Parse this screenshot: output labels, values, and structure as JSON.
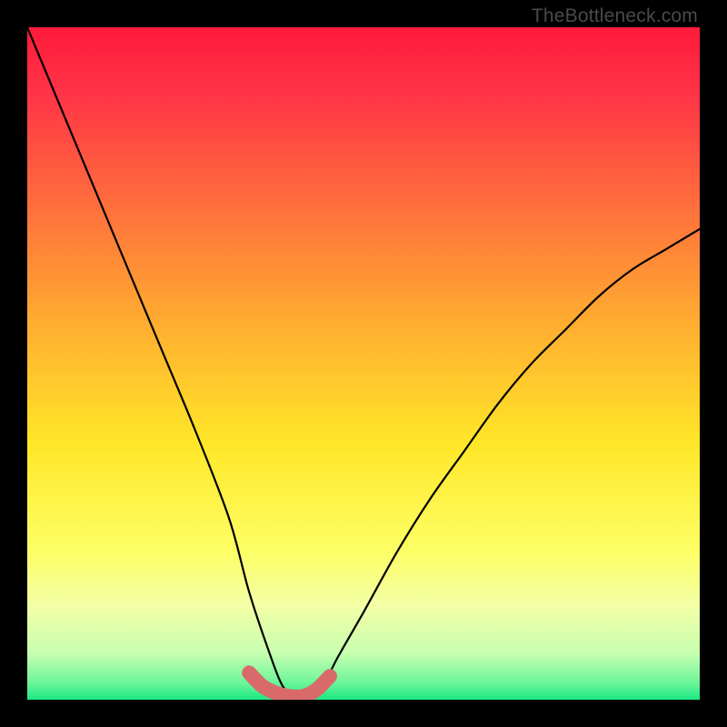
{
  "attribution": "TheBottleneck.com",
  "chart_data": {
    "type": "line",
    "title": "",
    "xlabel": "",
    "ylabel": "",
    "xlim": [
      0,
      100
    ],
    "ylim": [
      0,
      100
    ],
    "series": [
      {
        "name": "bottleneck-curve",
        "x": [
          0,
          5,
          10,
          15,
          20,
          25,
          30,
          33,
          36,
          38,
          40,
          42,
          44,
          46,
          50,
          55,
          60,
          65,
          70,
          75,
          80,
          85,
          90,
          95,
          100
        ],
        "y": [
          100,
          88,
          76,
          64,
          52,
          40,
          27,
          16,
          7,
          2,
          0,
          0,
          2,
          6,
          13,
          22,
          30,
          37,
          44,
          50,
          55,
          60,
          64,
          67,
          70
        ]
      },
      {
        "name": "optimal-highlight",
        "x": [
          33,
          35,
          37,
          39,
          41,
          43,
          45
        ],
        "y": [
          4,
          2,
          1,
          0.5,
          0.5,
          1.5,
          3.5
        ]
      }
    ],
    "gradient": {
      "stops": [
        {
          "pos": 0,
          "color": "#ff1a3a"
        },
        {
          "pos": 0.1,
          "color": "#ff3447"
        },
        {
          "pos": 0.45,
          "color": "#ffb030"
        },
        {
          "pos": 0.62,
          "color": "#ffe728"
        },
        {
          "pos": 0.78,
          "color": "#fdff66"
        },
        {
          "pos": 0.86,
          "color": "#f3ffa6"
        },
        {
          "pos": 0.93,
          "color": "#c8ffb0"
        },
        {
          "pos": 0.975,
          "color": "#6cf59a"
        },
        {
          "pos": 1.0,
          "color": "#1be884"
        }
      ]
    }
  }
}
